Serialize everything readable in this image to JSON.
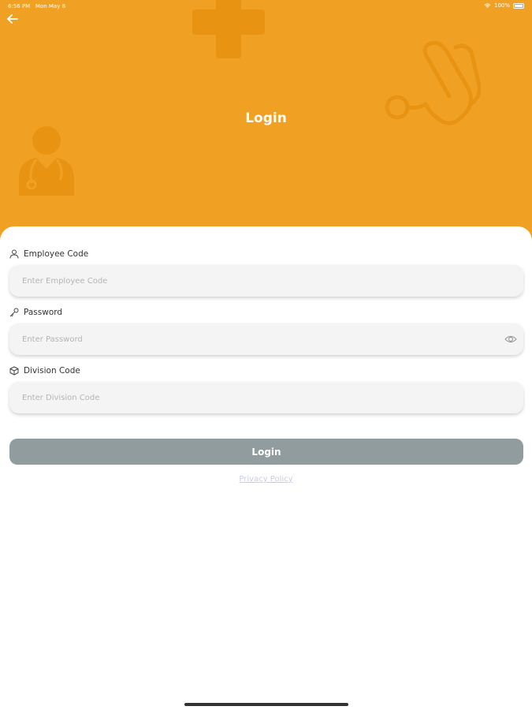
{
  "status_bar": {
    "time": "6:56 PM",
    "date": "Mon May 8",
    "battery": "100%"
  },
  "header": {
    "title": "Login",
    "background": "#F0A023"
  },
  "form": {
    "employee_code": {
      "label": "Employee Code",
      "placeholder": "Enter Employee Code"
    },
    "password": {
      "label": "Password",
      "placeholder": "Enter Password"
    },
    "division_code": {
      "label": "Division Code",
      "placeholder": "Enter Division Code"
    }
  },
  "login_button": {
    "label": "Login",
    "color": "#919C9F"
  },
  "privacy_link": {
    "label": "Privacy Policy"
  }
}
